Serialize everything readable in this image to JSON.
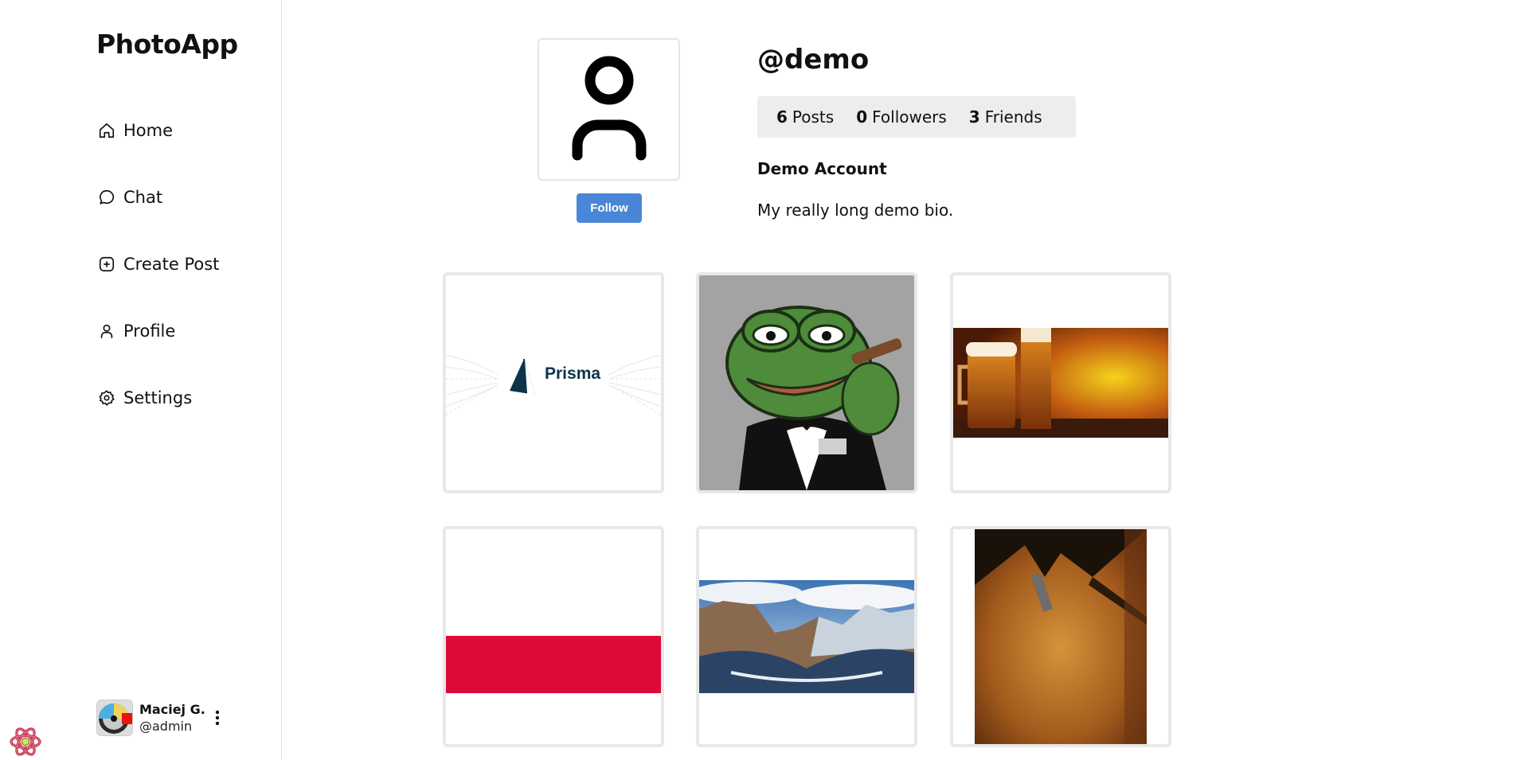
{
  "app": {
    "title": "PhotoApp"
  },
  "nav": {
    "home": "Home",
    "chat": "Chat",
    "create_post": "Create Post",
    "profile": "Profile",
    "settings": "Settings"
  },
  "current_user": {
    "name": "Maciej G.",
    "handle": "@admin"
  },
  "profile": {
    "username": "@demo",
    "follow_label": "Follow",
    "stats": {
      "posts_count": "6",
      "posts_label": "Posts",
      "followers_count": "0",
      "followers_label": "Followers",
      "friends_count": "3",
      "friends_label": "Friends"
    },
    "display_name": "Demo Account",
    "bio": "My really long demo bio."
  },
  "posts": [
    {
      "logo_text": "Prisma"
    },
    {},
    {},
    {},
    {},
    {}
  ],
  "colors": {
    "follow_button": "#4a86d8",
    "stats_background": "#ededed",
    "flag_red": "#dc0a37"
  }
}
